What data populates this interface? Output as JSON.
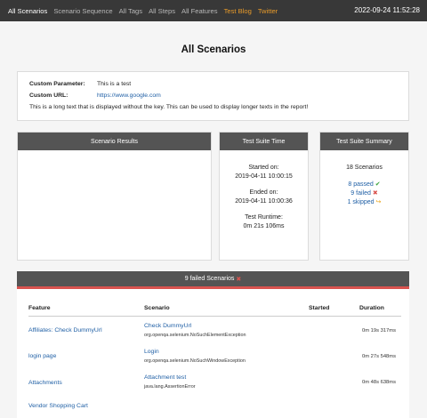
{
  "nav": {
    "links": [
      "All Scenarios",
      "Scenario Sequence",
      "All Tags",
      "All Steps",
      "All Features",
      "Test Blog",
      "Twitter"
    ],
    "datetime": "2022-09-24 11:52:28"
  },
  "title": "All Scenarios",
  "params": {
    "rows": [
      {
        "key": "Custom Parameter:",
        "value": "This is a test"
      },
      {
        "key": "Custom URL:",
        "value": "https://www.google.com"
      }
    ],
    "text": "This is a long text that is displayed without the key. This can be used to display longer texts in the report!"
  },
  "results": {
    "header": "Scenario Results"
  },
  "suite_time": {
    "header": "Test Suite Time",
    "started_label": "Started on:",
    "started": "2019-04-11 10:00:15",
    "ended_label": "Ended on:",
    "ended": "2019-04-11 10:00:36",
    "runtime_label": "Test Runtime:",
    "runtime": "0m 21s 106ms"
  },
  "summary": {
    "header": "Test Suite Summary",
    "count": "18 Scenarios",
    "passed": "8 passed",
    "failed": "9 failed",
    "skipped": "1 skipped",
    "passed_icon": "✔",
    "failed_icon": "✖",
    "skipped_icon": "↪"
  },
  "failed_table": {
    "header": "9 failed Scenarios",
    "header_icon": "✖",
    "columns": [
      "Feature",
      "Scenario",
      "Started",
      "Duration"
    ],
    "rows": [
      {
        "feature": "Affiliates: Check DummyUrl",
        "scenario": "Check DummyUrl",
        "error": "org.openqa.selenium.NoSuchElementException",
        "started": "",
        "duration": "0m 19s 317ms"
      },
      {
        "feature": "login page",
        "scenario": "Login",
        "error": "org.openqa.selenium.NoSuchWindowException",
        "started": "",
        "duration": "0m 27s 548ms"
      },
      {
        "feature": "Attachments",
        "scenario": "Attachment test",
        "error": "java.lang.AssertionError",
        "started": "",
        "duration": "0m 48s 638ms"
      },
      {
        "feature": "Vendor Shopping Cart",
        "scenario": "",
        "error": "",
        "started": "",
        "duration": ""
      }
    ]
  },
  "colors": {
    "navbar": "#383838",
    "header": "#545454",
    "link": "#1f5fa5",
    "failed": "#d9534f",
    "passed": "#3aa43a",
    "accent": "#e89b2a"
  }
}
